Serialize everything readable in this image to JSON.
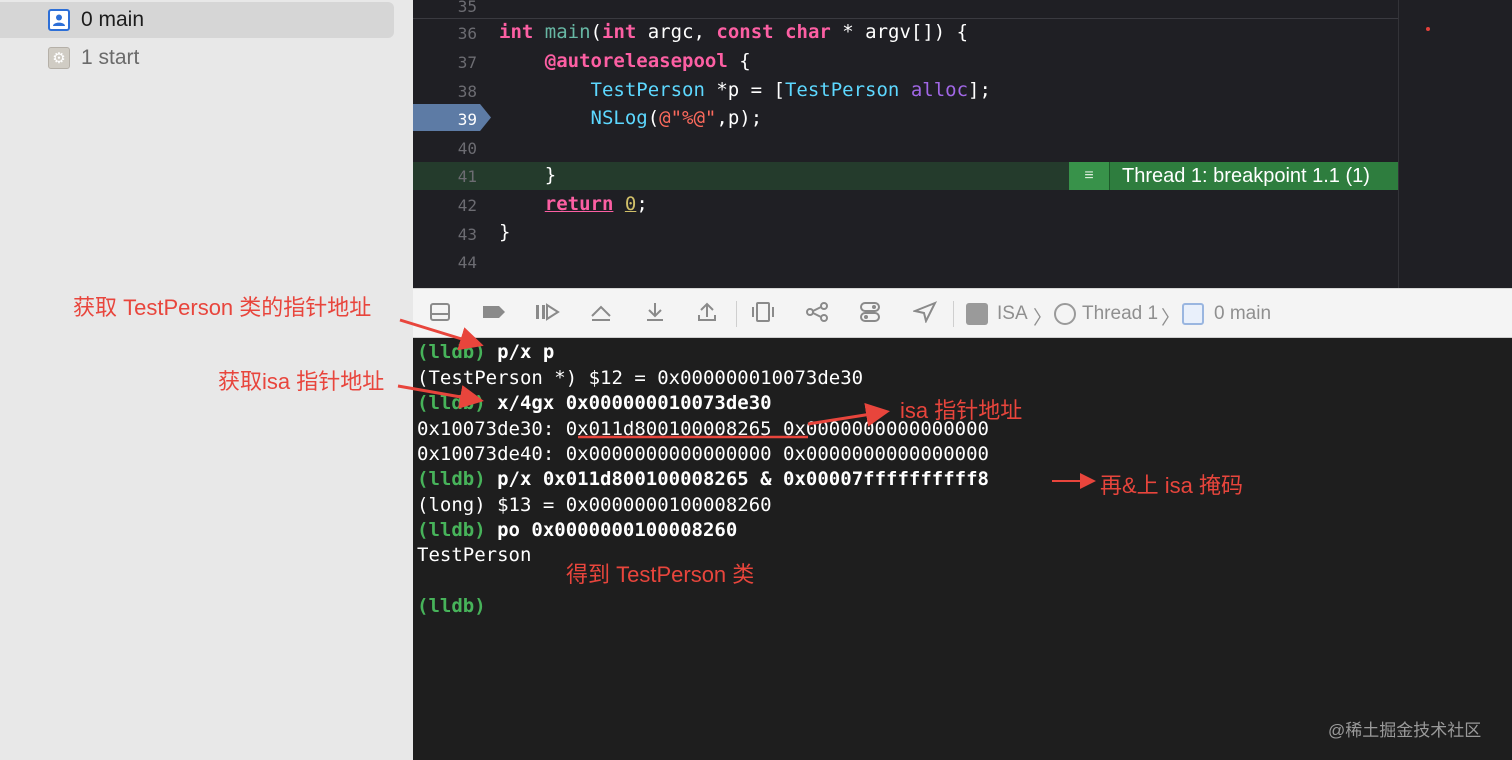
{
  "sidebar": {
    "frames": [
      {
        "label": "0 main",
        "icon": "user-icon",
        "selected": true
      },
      {
        "label": "1 start",
        "icon": "gear-icon",
        "selected": false
      }
    ]
  },
  "editor": {
    "line_numbers": [
      "35",
      "36",
      "37",
      "38",
      "39",
      "40",
      "41",
      "42",
      "43",
      "44"
    ],
    "breakpoint_line": "39",
    "current_line": "41",
    "thread_badge": "Thread 1: breakpoint 1.1 (1)",
    "code": {
      "l36": {
        "int1": "int",
        "main": "main",
        "p1": "(",
        "int2": "int",
        "sp": " argc, ",
        "const": "const",
        "sp2": " ",
        "char": "char",
        "rest": " * argv[]) {"
      },
      "l37": {
        "arp": "@autoreleasepool",
        "rest": " {"
      },
      "l38": {
        "type1": "TestPerson",
        "mid": " *p = [",
        "type2": "TestPerson",
        "sp": " ",
        "alloc": "alloc",
        "end": "];"
      },
      "l39": {
        "nslog": "NSLog",
        "p1": "(",
        "str": "@\"%@\"",
        "end": ",p);"
      },
      "l41": {
        "brace": "}"
      },
      "l42": {
        "ret": "return",
        "sp": " ",
        "zero": "0",
        "end": ";"
      },
      "l43": {
        "brace": "}"
      }
    }
  },
  "toolbar": {
    "breadcrumb": [
      "ISA",
      "Thread 1",
      "0 main"
    ]
  },
  "console": {
    "lines": [
      {
        "prompt": "(lldb)",
        "cmd": " p/x p"
      },
      {
        "text": "(TestPerson *) $12 = 0x000000010073de30"
      },
      {
        "prompt": "(lldb)",
        "cmd": " x/4gx 0x000000010073de30"
      },
      {
        "text": "0x10073de30: 0x011d800100008265 0x0000000000000000"
      },
      {
        "text": "0x10073de40: 0x0000000000000000 0x0000000000000000"
      },
      {
        "prompt": "(lldb)",
        "cmd": " p/x 0x011d800100008265 & 0x00007ffffffffff8"
      },
      {
        "text": "(long) $13 = 0x0000000100008260"
      },
      {
        "prompt": "(lldb)",
        "cmd": " po 0x0000000100008260"
      },
      {
        "text": "TestPerson"
      },
      {
        "text": ""
      },
      {
        "prompt": "(lldb)",
        "cmd": ""
      }
    ]
  },
  "annotations": {
    "get_class_ptr": "获取 TestPerson 类的指针地址",
    "get_isa_ptr": "获取isa 指针地址",
    "isa_addr": "isa 指针地址",
    "and_mask": "再&上 isa 掩码",
    "got_class": "得到 TestPerson 类"
  },
  "watermark": "@稀土掘金技术社区",
  "colors": {
    "annotation": "#e8453c",
    "prompt": "#47b35a",
    "thread_badge": "#2e7d3e",
    "breakpoint": "#5d7ba5"
  }
}
